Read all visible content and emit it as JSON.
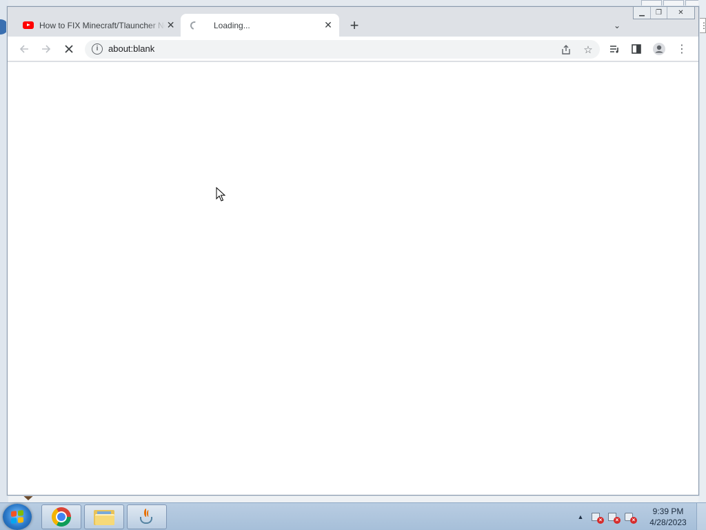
{
  "browser": {
    "tabs": [
      {
        "title": "How to FIX Minecraft/Tlauncher Not Launching",
        "favicon": "youtube-icon",
        "active": false
      },
      {
        "title": "Loading...",
        "favicon": "loading-spinner-icon",
        "active": true
      }
    ],
    "address_bar": {
      "url": "about:blank"
    },
    "new_tab_label": "+",
    "icons": {
      "back": "back-arrow-icon",
      "forward": "forward-arrow-icon",
      "stop": "stop-loading-icon",
      "site_info": "info-icon",
      "share": "share-icon",
      "bookmark": "star-icon",
      "media": "media-control-icon",
      "side_panel": "side-panel-icon",
      "profile": "profile-icon",
      "menu": "more-vert-icon",
      "tab_search": "chevron-down-icon"
    },
    "accent_colors": {
      "youtube": "#ff0000",
      "tabstrip": "#dee1e6",
      "omnibox": "#f1f3f4"
    }
  },
  "taskbar": {
    "pinned": [
      {
        "name": "Google Chrome",
        "icon": "chrome-icon"
      },
      {
        "name": "Windows Explorer",
        "icon": "folder-icon"
      },
      {
        "name": "Java",
        "icon": "java-icon"
      }
    ],
    "clock": {
      "time": "9:39 PM",
      "date": "4/28/2023"
    }
  }
}
